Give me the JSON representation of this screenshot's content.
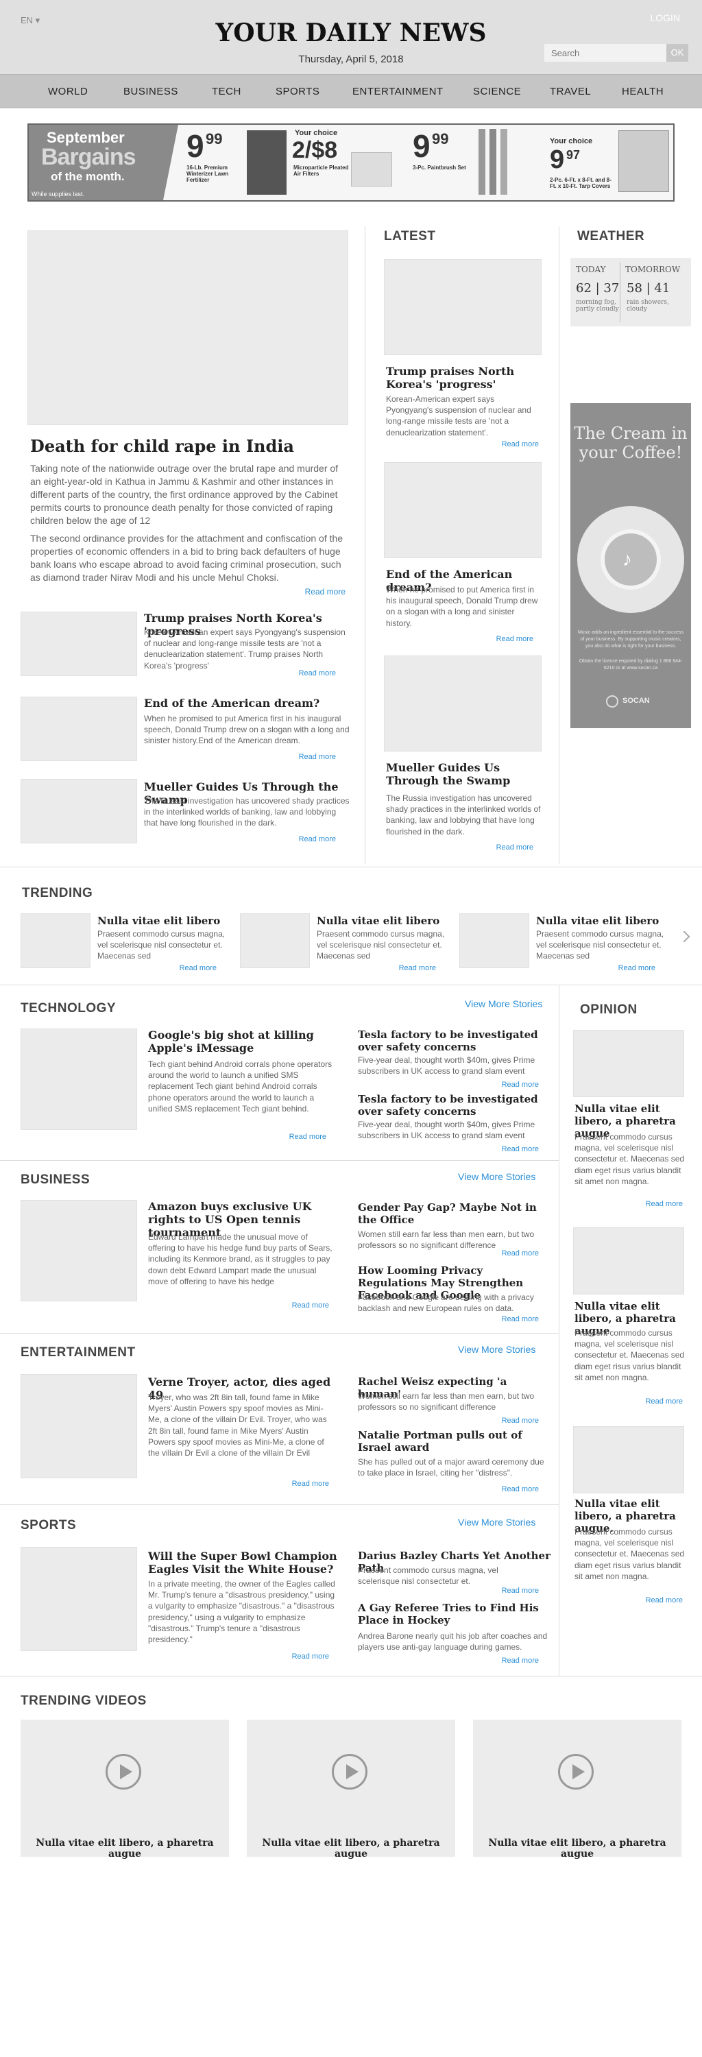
{
  "header": {
    "lang": "EN ▾",
    "login": "LOGIN",
    "masthead": "YOUR DAILY NEWS",
    "date": "Thursday, April 5, 2018",
    "search_placeholder": "Search",
    "ok": "OK"
  },
  "nav": [
    "WORLD",
    "BUSINESS",
    "TECH",
    "SPORTS",
    "ENTERTAINMENT",
    "SCIENCE",
    "TRAVEL",
    "HEALTH"
  ],
  "banner": {
    "l1": "September",
    "l2": "Bargains",
    "l3": "of the month.",
    "note": "While supplies last.",
    "p1": "9",
    "p1c": "99",
    "d1": "16-Lb. Premium Winterizer Lawn Fertilizer",
    "c2": "Your choice",
    "p2": "2/$8",
    "d2": "Microparticle Pleated Air Filters",
    "p3": "9",
    "p3c": "99",
    "d3": "3-Pc. Paintbrush Set",
    "c4": "Your choice",
    "p4": "9",
    "p4c": "97",
    "d4": "2-Pc. 6-Ft. x 8-Ft. and 8-Ft. x 10-Ft. Tarp Covers"
  },
  "lead": {
    "title": "Death for child rape in India",
    "p1": "Taking note of the nationwide outrage over the brutal rape and murder of an eight-year-old in Kathua in Jammu & Kashmir and other instances in different parts of the country, the first ordinance approved by the Cabinet permits courts to pronounce death penalty for those convicted of raping children below the age of 12",
    "p2": "The second ordinance provides for the attachment and confiscation of the properties of economic offenders in a bid to bring back defaulters of huge bank loans who escape abroad to avoid facing criminal prosecution, such as diamond trader Nirav Modi and his uncle Mehul Choksi.",
    "read": "Read more"
  },
  "small_stories": [
    {
      "title": "Trump praises North Korea's 'progress",
      "text": "Korean-American expert says Pyongyang's suspension of nuclear and long-range missile tests are 'not a denuclearization statement'. Trump praises North Korea's 'progress'",
      "read": "Read more"
    },
    {
      "title": "End of the American dream?",
      "text": "When he promised to put America first in his inaugural speech, Donald Trump drew on a slogan with a long and sinister history.End of the American dream.",
      "read": "Read more"
    },
    {
      "title": "Mueller Guides Us Through the Swamp",
      "text": "The Russia investigation has uncovered shady practices in the interlinked worlds of banking, law and lobbying that have long flourished in the dark.",
      "read": "Read more"
    }
  ],
  "latest": {
    "heading": "LATEST",
    "items": [
      {
        "title": "Trump praises North Korea's 'progress'",
        "text": "Korean-American expert says Pyongyang's suspension of nuclear and long-range missile tests are 'not a denuclearization statement'.",
        "read": "Read more"
      },
      {
        "title": "End of the American dream?",
        "text": "When he promised to put America first in his inaugural speech, Donald Trump drew on a slogan with a long and sinister history.",
        "read": "Read more"
      },
      {
        "title": "Mueller Guides Us Through the Swamp",
        "text": "The Russia investigation has uncovered shady practices in the interlinked worlds of banking, law and lobbying that have long flourished in the dark.",
        "read": "Read more"
      }
    ]
  },
  "weather": {
    "heading": "WEATHER",
    "today": "TODAY",
    "today_temp": "62 | 37",
    "today_desc": "morning fog, partly cloudly",
    "tomorrow": "TOMORROW",
    "tomorrow_temp": "58 | 41",
    "tomorrow_desc": "rain showers, cloudy"
  },
  "ad": {
    "line1": "The Cream in",
    "line2": "your Coffee!",
    "small1": "Music adds an ingredient essential to the success of your business. By supporting music creators, you also do what is right for your business.",
    "small2": "Obtain the licence required by dialing 1 866 944-6210 or at www.socan.ca",
    "brand": "SOCAN"
  },
  "trending": {
    "heading": "TRENDING",
    "items": [
      {
        "title": "Nulla vitae elit libero",
        "text": "Praesent commodo cursus magna, vel scelerisque nisl consectetur et. Maecenas sed",
        "read": "Read more"
      },
      {
        "title": "Nulla vitae elit libero",
        "text": "Praesent commodo cursus magna, vel scelerisque nisl consectetur et. Maecenas sed",
        "read": "Read more"
      },
      {
        "title": "Nulla vitae elit libero",
        "text": "Praesent commodo cursus magna, vel scelerisque nisl consectetur et. Maecenas sed",
        "read": "Read more"
      }
    ]
  },
  "sections": [
    {
      "heading": "TECHNOLOGY",
      "more": "View More Stories",
      "main": {
        "title": "Google's big shot at killing Apple's iMessage",
        "text": "Tech giant behind Android corrals phone operators around the world to launch a unified SMS replacement Tech giant behind Android corrals phone operators around the world to launch a unified SMS replacement Tech giant behind.",
        "read": "Read more"
      },
      "side": [
        {
          "title": "Tesla factory to be investigated over safety concerns",
          "text": "Five-year deal, thought worth $40m, gives Prime subscribers in UK access to grand slam event",
          "read": "Read more"
        },
        {
          "title": "Tesla factory to be investigated over safety concerns",
          "text": "Five-year deal, thought worth $40m, gives Prime subscribers in UK access to grand slam event",
          "read": "Read more"
        }
      ]
    },
    {
      "heading": "BUSINESS",
      "more": "View More Stories",
      "main": {
        "title": "Amazon buys exclusive UK rights to US Open tennis tournament",
        "text": "Edward Lampart made the unusual move of offering to have his hedge fund buy parts of Sears, including its Kenmore brand, as it struggles to pay down debt Edward Lampart made the unusual move of offering to have his hedge",
        "read": "Read more"
      },
      "side": [
        {
          "title": "Gender Pay Gap? Maybe Not in the Office",
          "text": "Women still earn far less  than men earn, but two professors so no significant difference",
          "read": "Read more"
        },
        {
          "title": "How Looming Privacy Regulations May Strengthen Facebook and Google",
          "text": "Facebook and Google are dealing with a privacy backlash and new European rules on data.",
          "read": "Read more"
        }
      ]
    },
    {
      "heading": "ENTERTAINMENT",
      "more": "View More Stories",
      "main": {
        "title": "Verne Troyer, actor, dies aged 49",
        "text": "Troyer, who was 2ft 8in tall, found fame in Mike Myers' Austin Powers spy spoof movies as Mini-Me,  a clone of the villain Dr Evil. Troyer, who was 2ft 8in tall, found fame in Mike Myers' Austin Powers spy spoof movies as Mini-Me,  a clone of the villain Dr Evil a clone of the villain Dr Evil",
        "read": "Read more"
      },
      "side": [
        {
          "title": "Rachel Weisz expecting 'a human'",
          "text": "Women still earn far less  than men earn, but two professors so no significant difference",
          "read": "Read more"
        },
        {
          "title": "Natalie Portman pulls out of Israel award",
          "text": "She has pulled out of a major award ceremony due to take place in Israel, citing her \"distress\".",
          "read": "Read more"
        }
      ]
    },
    {
      "heading": "SPORTS",
      "more": "View More Stories",
      "main": {
        "title": "Will the Super Bowl Champion Eagles Visit the White House?",
        "text": "In a private meeting, the owner of the Eagles called Mr. Trump's tenure a \"disastrous presidency,\" using a vulgarity to emphasize \"disastrous.\" a \"disastrous presidency,\" using a vulgarity to emphasize \"disastrous.\" Trump's tenure a \"disastrous presidency.\"",
        "read": "Read more"
      },
      "side": [
        {
          "title": "Darius Bazley Charts Yet Another Path",
          "text": "Praesent commodo cursus magna, vel scelerisque nisl consectetur et.",
          "read": "Read more"
        },
        {
          "title": "A Gay Referee Tries to Find His Place in Hockey",
          "text": "Andrea Barone nearly quit his job after coaches and players use anti-gay language during games.",
          "read": "Read more"
        }
      ]
    }
  ],
  "opinion": {
    "heading": "OPINION",
    "items": [
      {
        "title": "Nulla vitae elit libero, a pharetra augue",
        "text": "Praesent commodo cursus magna, vel scelerisque nisl consectetur et. Maecenas sed diam eget risus varius blandit sit amet non magna.",
        "read": "Read more"
      },
      {
        "title": "Nulla vitae elit libero, a pharetra augue",
        "text": "Praesent commodo cursus magna, vel scelerisque nisl consectetur et. Maecenas sed diam eget risus varius blandit sit amet non magna.",
        "read": "Read more"
      },
      {
        "title": "Nulla vitae elit libero, a pharetra augue.",
        "text": "Praesent commodo cursus magna, vel scelerisque nisl consectetur et. Maecenas sed diam eget risus varius blandit sit amet non magna.",
        "read": "Read more"
      }
    ]
  },
  "videos": {
    "heading": "TRENDING VIDEOS",
    "items": [
      {
        "title": "Nulla vitae elit libero, a pharetra augue"
      },
      {
        "title": "Nulla vitae elit libero, a pharetra augue"
      },
      {
        "title": "Nulla vitae elit libero, a pharetra augue"
      }
    ]
  },
  "colors": {
    "link": "#2b8fd6",
    "header_bg": "#e0e0e0",
    "nav_bg": "#c5c5c5"
  }
}
